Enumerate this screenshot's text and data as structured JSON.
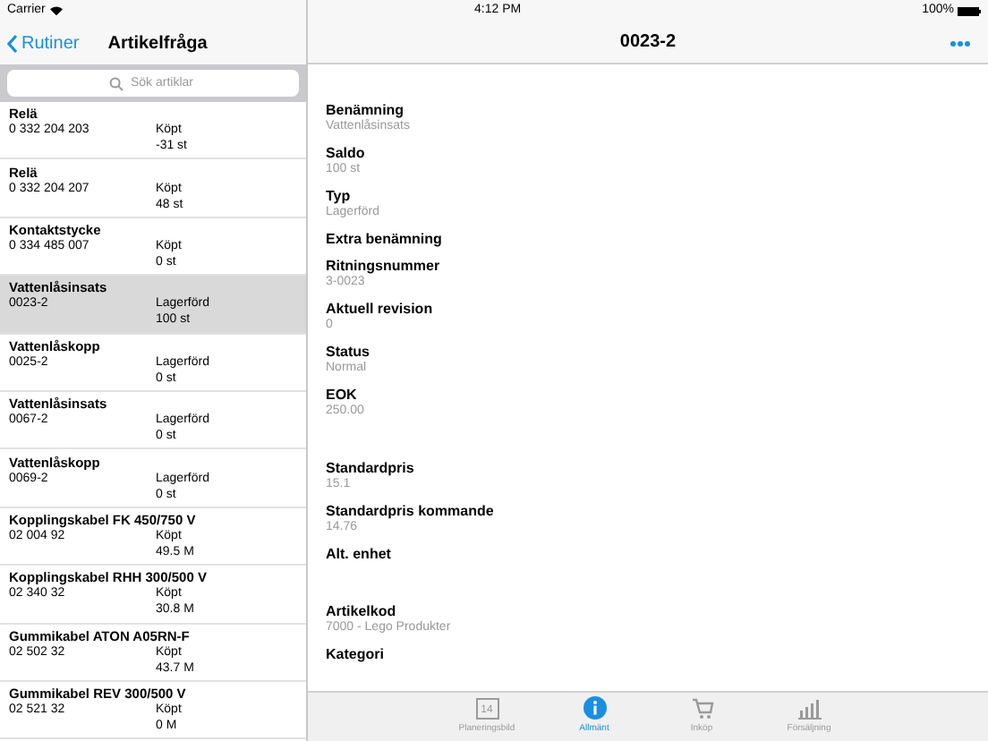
{
  "status_bar": {
    "carrier": "Carrier",
    "time": "4:12 PM",
    "battery_text": "100%"
  },
  "nav": {
    "back": "Rutiner",
    "title": "Artikelfråga",
    "detail_title": "0023-2"
  },
  "search": {
    "placeholder": "Sök artiklar"
  },
  "articles": [
    {
      "name": "Relä",
      "code": "0 332 204 203",
      "type": "Köpt",
      "qty": "-31 st",
      "selected": false
    },
    {
      "name": "Relä",
      "code": "0 332 204 207",
      "type": "Köpt",
      "qty": "48 st",
      "selected": false
    },
    {
      "name": "Kontaktstycke",
      "code": "0 334 485 007",
      "type": "Köpt",
      "qty": "0 st",
      "selected": false
    },
    {
      "name": "Vattenlåsinsats",
      "code": "0023-2",
      "type": "Lagerförd",
      "qty": "100 st",
      "selected": true
    },
    {
      "name": "Vattenlåskopp",
      "code": "0025-2",
      "type": "Lagerförd",
      "qty": "0 st",
      "selected": false
    },
    {
      "name": "Vattenlåsinsats",
      "code": "0067-2",
      "type": "Lagerförd",
      "qty": "0 st",
      "selected": false
    },
    {
      "name": "Vattenlåskopp",
      "code": "0069-2",
      "type": "Lagerförd",
      "qty": "0 st",
      "selected": false
    },
    {
      "name": "Kopplingskabel FK 450/750 V",
      "code": "02 004 92",
      "type": "Köpt",
      "qty": "49.5 M",
      "selected": false
    },
    {
      "name": "Kopplingskabel RHH 300/500 V",
      "code": "02 340 32",
      "type": "Köpt",
      "qty": "30.8 M",
      "selected": false
    },
    {
      "name": "Gummikabel ATON A05RN-F",
      "code": "02 502 32",
      "type": "Köpt",
      "qty": "43.7 M",
      "selected": false
    },
    {
      "name": "Gummikabel REV 300/500 V",
      "code": "02 521 32",
      "type": "Köpt",
      "qty": "0 M",
      "selected": false
    }
  ],
  "sections": [
    {
      "fields": [
        {
          "label": "Benämning",
          "value": "Vattenlåsinsats"
        },
        {
          "label": "Saldo",
          "value": "100 st"
        },
        {
          "label": "Typ",
          "value": "Lagerförd"
        },
        {
          "label": "Extra benämning"
        },
        {
          "label": "Ritningsnummer",
          "value": "3-0023"
        },
        {
          "label": "Aktuell revision",
          "value": "0"
        },
        {
          "label": "Status",
          "value": "Normal"
        },
        {
          "label": "EOK",
          "value": "250.00"
        }
      ]
    },
    {
      "fields": [
        {
          "label": "Standardpris",
          "value": "15.1"
        },
        {
          "label": "Standardpris kommande",
          "value": "14.76"
        },
        {
          "label": "Alt. enhet"
        }
      ]
    },
    {
      "fields": [
        {
          "label": "Artikelkod",
          "value": "7000 - Lego Produkter"
        },
        {
          "label": "Kategori"
        }
      ]
    }
  ],
  "tabs": [
    {
      "kind": "calendar",
      "label": "Planeringsbild",
      "icon_text": "14",
      "selected": false
    },
    {
      "kind": "info",
      "label": "Allmänt",
      "selected": true
    },
    {
      "kind": "cart",
      "label": "Inköp",
      "selected": false
    },
    {
      "kind": "chart",
      "label": "Försäljning",
      "selected": false
    }
  ]
}
